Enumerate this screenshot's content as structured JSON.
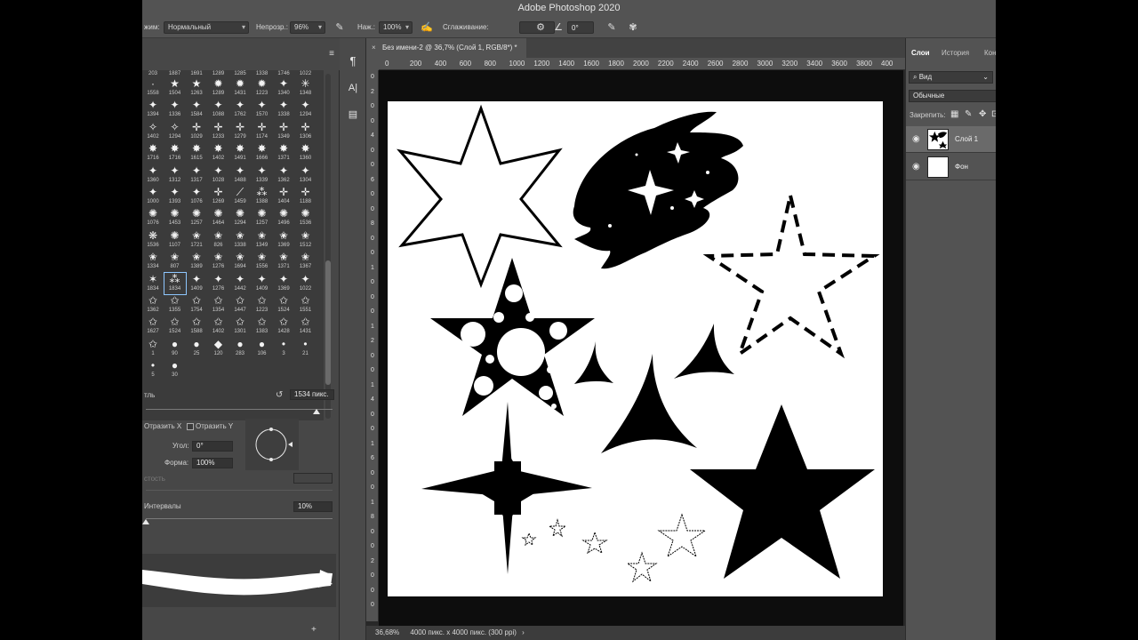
{
  "app": {
    "title": "Adobe Photoshop 2020"
  },
  "options": {
    "mode_label": "жим:",
    "mode_value": "Нормальный",
    "opacity_label": "Непрозр.:",
    "opacity_value": "96%",
    "pressure_label": "Наж.:",
    "pressure_value": "100%",
    "smoothing_label": "Сглаживание:",
    "angle_value": "0°"
  },
  "brushes": {
    "menu_icon": "≡",
    "rows": [
      {
        "g": [
          "·",
          "★",
          "★",
          "✹",
          "✹",
          "✹",
          "✦",
          "✳",
          "✦"
        ],
        "n": [
          "1558",
          "1504",
          "1263",
          "1289",
          "1431",
          "1223",
          "1340",
          "1348",
          ""
        ]
      },
      {
        "g": [
          "✦",
          "✦",
          "✦",
          "✦",
          "✦",
          "✦",
          "✦",
          "✦",
          "✦"
        ],
        "n": [
          "1394",
          "1336",
          "1584",
          "1088",
          "1762",
          "1570",
          "1338",
          "1294",
          ""
        ]
      },
      {
        "g": [
          "✧",
          "✧",
          "✛",
          "✛",
          "✛",
          "✛",
          "✛",
          "✛",
          "✛"
        ],
        "n": [
          "1402",
          "1294",
          "1029",
          "1233",
          "1279",
          "1174",
          "1349",
          "1306",
          ""
        ]
      },
      {
        "g": [
          "✸",
          "✸",
          "✸",
          "✸",
          "✸",
          "✸",
          "✸",
          "✸",
          "✸"
        ],
        "n": [
          "1716",
          "1716",
          "1615",
          "1402",
          "1491",
          "1666",
          "1371",
          "1360",
          ""
        ]
      },
      {
        "g": [
          "✦",
          "✦",
          "✦",
          "✦",
          "✦",
          "✦",
          "✦",
          "✦",
          "✦"
        ],
        "n": [
          "1360",
          "1312",
          "1317",
          "1028",
          "1488",
          "1339",
          "1362",
          "1304",
          ""
        ]
      },
      {
        "g": [
          "✦",
          "✦",
          "✦",
          "✛",
          "⟋",
          "⁂",
          "✛",
          "✛",
          "✛"
        ],
        "n": [
          "1000",
          "1393",
          "1076",
          "1269",
          "1459",
          "1388",
          "1404",
          "1188",
          ""
        ]
      },
      {
        "g": [
          "✺",
          "✺",
          "✺",
          "✺",
          "✺",
          "✺",
          "✺",
          "✺",
          "✺"
        ],
        "n": [
          "1076",
          "1453",
          "1257",
          "1464",
          "1294",
          "1257",
          "1496",
          "1536",
          ""
        ]
      },
      {
        "g": [
          "❋",
          "✺",
          "✬",
          "✬",
          "✬",
          "✬",
          "✬",
          "✬",
          "✬"
        ],
        "n": [
          "1536",
          "1107",
          "1721",
          "826",
          "1338",
          "1349",
          "1369",
          "1512",
          ""
        ]
      },
      {
        "g": [
          "✬",
          "✬",
          "✬",
          "✬",
          "✬",
          "✬",
          "✬",
          "✬",
          "✬"
        ],
        "n": [
          "1334",
          "807",
          "1389",
          "1276",
          "1694",
          "1556",
          "1371",
          "1367",
          ""
        ]
      },
      {
        "g": [
          "✶",
          "⁂",
          "✦",
          "✦",
          "✦",
          "✦",
          "✦",
          "✦",
          "✦"
        ],
        "n": [
          "1834",
          "1834",
          "1409",
          "1276",
          "1442",
          "1409",
          "1369",
          "1022",
          ""
        ]
      },
      {
        "g": [
          "✩",
          "✩",
          "✩",
          "✩",
          "✩",
          "✩",
          "✩",
          "✩",
          "✩"
        ],
        "n": [
          "1362",
          "1355",
          "1754",
          "1354",
          "1447",
          "1223",
          "1524",
          "1551",
          ""
        ]
      },
      {
        "g": [
          "✩",
          "✩",
          "✩",
          "✩",
          "✩",
          "✩",
          "✩",
          "✩",
          "✩"
        ],
        "n": [
          "1627",
          "1524",
          "1588",
          "1402",
          "1301",
          "1383",
          "1428",
          "1431",
          ""
        ]
      },
      {
        "g": [
          "✩",
          "●",
          "●",
          "◆",
          "●",
          "●",
          "•",
          "•",
          ""
        ],
        "n": [
          "1",
          "90",
          "25",
          "120",
          "283",
          "106",
          "3",
          "21",
          ""
        ]
      },
      {
        "g": [
          "•",
          "●",
          "",
          "",
          "",
          "",
          "",
          "",
          ""
        ],
        "n": [
          "5",
          "30",
          "",
          "",
          "",
          "",
          "",
          "",
          ""
        ]
      }
    ],
    "top_numbers": [
      "203",
      "1887",
      "1691",
      "1289",
      "1285",
      "1338",
      "1746",
      "1022"
    ],
    "size_label": "тль",
    "size_value": "1534 пикс.",
    "flip_x": "Отразить X",
    "flip_y": "Отразить Y",
    "angle_label": "Угол:",
    "angle_value": "0°",
    "roundness_label": "Форма:",
    "roundness_value": "100%",
    "hardness_label": "стость",
    "spacing_label": "Интервалы",
    "spacing_value": "10%",
    "new_icon": "+"
  },
  "tools": [
    "¶",
    "A|",
    "▤"
  ],
  "document": {
    "tab_title": "Без имени-2 @ 36,7% (Слой 1, RGB/8*) *",
    "close_icon": "×",
    "ruler_h": [
      "0",
      "200",
      "400",
      "600",
      "800",
      "1000",
      "1200",
      "1400",
      "1600",
      "1800",
      "2000",
      "2200",
      "2400",
      "2600",
      "2800",
      "3000",
      "3200",
      "3400",
      "3600",
      "3800",
      "400"
    ],
    "ruler_v": [
      "0",
      "2",
      "0",
      "0",
      "4",
      "0",
      "0",
      "6",
      "0",
      "0",
      "8",
      "0",
      "0",
      "1",
      "0",
      "0",
      "0",
      "1",
      "2",
      "0",
      "0",
      "1",
      "4",
      "0",
      "0",
      "1",
      "6",
      "0",
      "0",
      "1",
      "8",
      "0",
      "0",
      "2",
      "0",
      "0",
      "0"
    ],
    "status_zoom": "36,68%",
    "status_info": "4000 пикс. x 4000 пикс. (300 ppi)",
    "status_arrow": "›"
  },
  "layers_panel": {
    "tabs": [
      "Слои",
      "История",
      "Кон"
    ],
    "filter_value": "Вид",
    "blend_value": "Обычные",
    "lock_label": "Закрепить:",
    "layers": [
      {
        "name": "Слой 1",
        "active": true
      },
      {
        "name": "Фон",
        "active": false
      }
    ]
  }
}
